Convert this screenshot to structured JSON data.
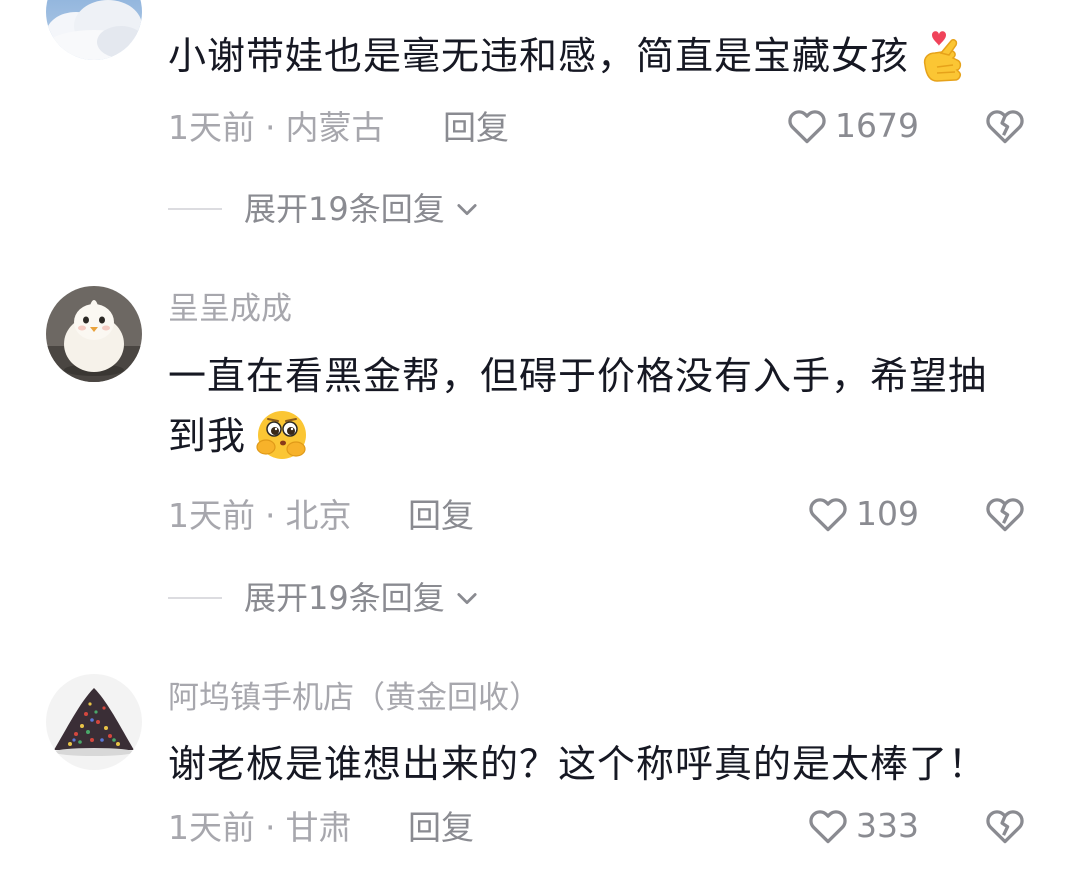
{
  "comments": [
    {
      "username": "",
      "text": "小谢带娃也是毫无违和感，简直是宝藏女孩",
      "text_line2": "",
      "emoji": "finger-heart-emoji",
      "time": "1天前",
      "separator": "·",
      "location": "内蒙古",
      "reply_label": "回复",
      "likes": "1679",
      "expand_label": "展开19条回复"
    },
    {
      "username": "呈呈成成",
      "text": "一直在看黑金帮，但碍于价格没有入手，希望抽",
      "text_line2": "到我",
      "emoji": "pleading-face-emoji",
      "time": "1天前",
      "separator": "·",
      "location": "北京",
      "reply_label": "回复",
      "likes": "109",
      "expand_label": "展开19条回复"
    },
    {
      "username": "阿坞镇手机店（黄金回收）",
      "text": "谢老板是谁想出来的？这个称呼真的是太棒了！",
      "text_line2": "",
      "emoji": "",
      "time": "1天前",
      "separator": "·",
      "location": "甘肃",
      "reply_label": "回复",
      "likes": "333",
      "expand_label": ""
    }
  ],
  "icons": {
    "like": "heart-outline-icon",
    "dislike": "broken-heart-icon",
    "expand": "chevron-down-icon"
  },
  "colors": {
    "text_primary": "#161823",
    "text_secondary": "#a7a7ad",
    "text_action": "#8a8b91",
    "divider": "#dcdce0"
  }
}
